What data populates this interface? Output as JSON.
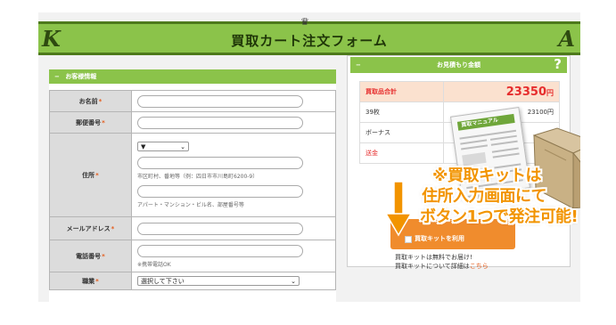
{
  "header": {
    "title": "買取カート注文フォーム",
    "monogram_left": "K",
    "monogram_right": "A",
    "crest": "♛"
  },
  "customer": {
    "section_title": "お客様情報",
    "collapse_icon": "minus-icon",
    "required_mark": "*",
    "fields": {
      "name_label": "お名前",
      "postal_label": "郵便番号",
      "address_label": "住所",
      "address_pref_value": "▼",
      "address_city_note": "市区町村、番地等（例：四日市市川島町6200-9）",
      "address_building_note": "アパート・マンション・ビル名、部屋番号等",
      "email_label": "メールアドレス",
      "phone_label": "電話番号",
      "phone_note": "※携帯電話OK",
      "job_label": "職業",
      "job_value": "選択して下さい"
    }
  },
  "estimate": {
    "section_title": "お見積もり金額",
    "help_icon": "?",
    "rows": [
      {
        "label": "買取品合計",
        "amount": "23350",
        "unit": "円"
      },
      {
        "label": "39枚",
        "amount": "23100円"
      },
      {
        "label": "ボーナス",
        "amount": ""
      },
      {
        "label": "送金",
        "amount": ""
      }
    ],
    "kit_checkbox_label": "買取キットを利用",
    "note_line1": "買取キットは無料でお届け!",
    "note_line2_prefix": "買取キットについて詳細は",
    "note_link": "こちら"
  },
  "promo": {
    "manual_title": "買取マニュアル",
    "callout_line1": "※買取キットは",
    "callout_line2": "住所入力画面にて",
    "callout_line3": "ボタン1つで発注可能!"
  },
  "colors": {
    "brand_green": "#8bc34a",
    "dark_green": "#4e7a1c",
    "accent_orange": "#f08c2d",
    "price_red": "#e62d2d",
    "callout_orange": "#f29400"
  }
}
